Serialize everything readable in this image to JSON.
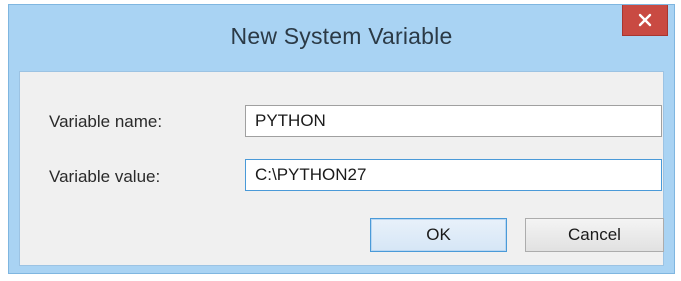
{
  "dialog": {
    "title": "New System Variable",
    "close_icon": "close-icon",
    "close_color": "#c94a42"
  },
  "form": {
    "name_label": "Variable name:",
    "name_value": "PYTHON",
    "value_label": "Variable value:",
    "value_value": "C:\\PYTHON27"
  },
  "buttons": {
    "ok_label": "OK",
    "cancel_label": "Cancel"
  },
  "colors": {
    "frame": "#a9d3f3",
    "content_bg": "#f0f0f0",
    "focus_border": "#4a9ad8"
  }
}
